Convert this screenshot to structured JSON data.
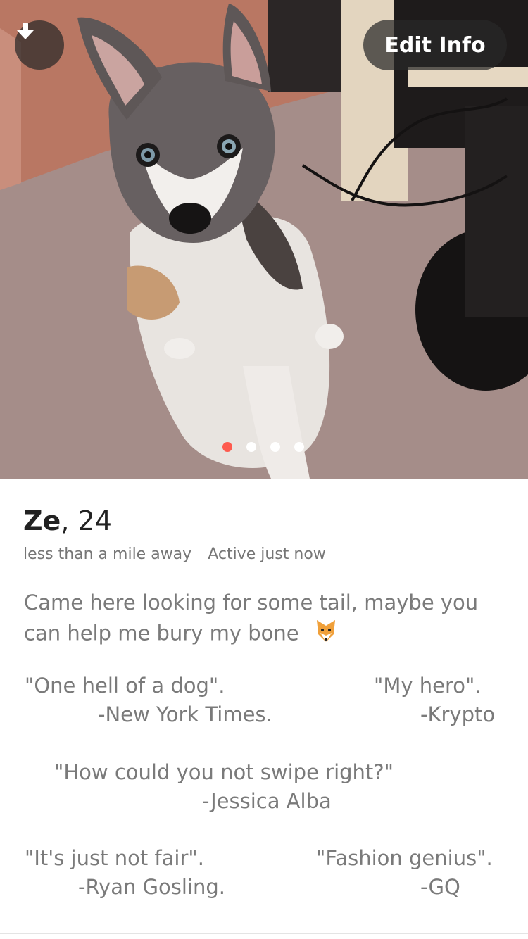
{
  "header": {
    "download_icon": "arrow-down-icon",
    "edit_label": "Edit Info"
  },
  "photo": {
    "subject": "dog-photo",
    "pager": {
      "count": 4,
      "active_index": 0
    },
    "active_dot_color": "#fe5a4e"
  },
  "profile": {
    "name": "Ze",
    "separator": ",",
    "age": "24",
    "distance": "less than a mile away",
    "activity": "Active just now",
    "bio": "Came here looking for some tail, maybe you can help me bury my bone",
    "bio_emoji": "fox-emoji"
  },
  "quotes": [
    {
      "quote": "\"One hell of a dog\".",
      "author": "-New York Times."
    },
    {
      "quote": "\"My hero\".",
      "author": "-Krypto"
    },
    {
      "quote": "\"How could you not swipe right?\"",
      "author": "-Jessica Alba"
    },
    {
      "quote": "\"It's just not fair\".",
      "author": "-Ryan Gosling."
    },
    {
      "quote": "\"Fashion genius\".",
      "author": "-GQ"
    }
  ]
}
